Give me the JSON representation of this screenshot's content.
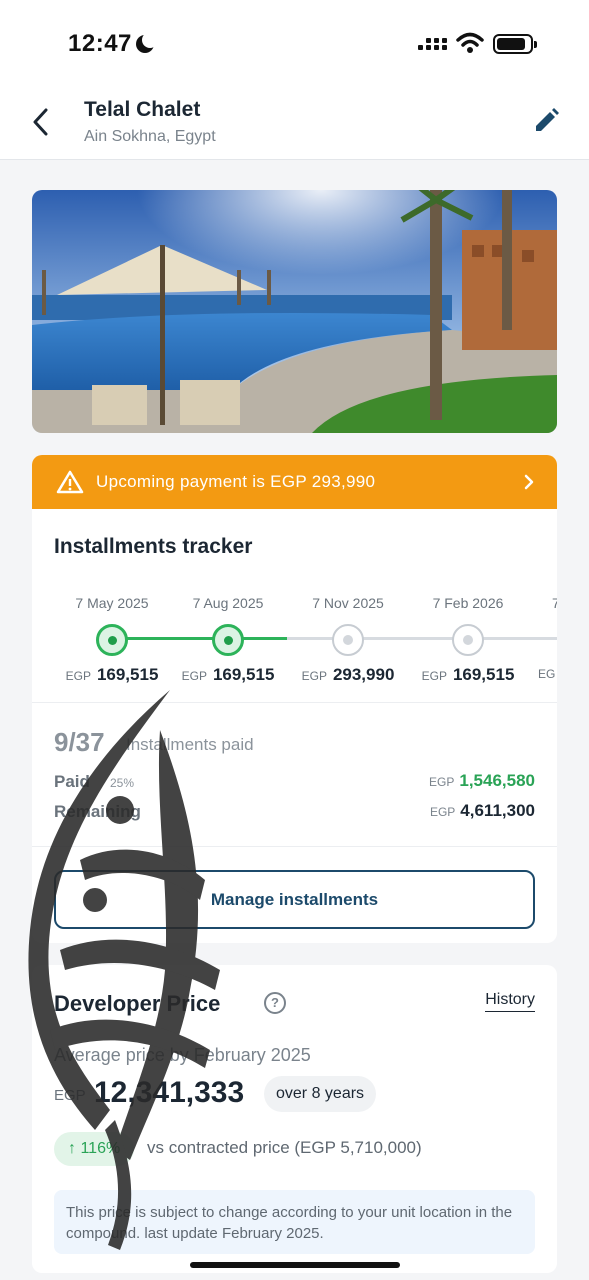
{
  "status_bar": {
    "time": "12:47",
    "icons": [
      "moon-icon",
      "signal-icon",
      "wifi-icon",
      "battery-icon"
    ]
  },
  "header": {
    "title": "Telal Chalet",
    "subtitle": "Ain Sokhna, Egypt",
    "back_icon": "chevron-left-icon",
    "edit_icon": "pencil-icon"
  },
  "alert": {
    "text": "Upcoming payment is EGP 293,990",
    "color": "#f39a12"
  },
  "tracker": {
    "title": "Installments tracker",
    "currency": "EGP",
    "items": [
      {
        "date": "7 May 2025",
        "amount": "169,515",
        "status": "paid"
      },
      {
        "date": "7 Aug 2025",
        "amount": "169,515",
        "status": "paid"
      },
      {
        "date": "7 Nov 2025",
        "amount": "293,990",
        "status": "upcoming"
      },
      {
        "date": "7 Feb 2026",
        "amount": "169,515",
        "status": "upcoming"
      },
      {
        "date": "7",
        "amount": "",
        "status": "upcoming"
      }
    ],
    "partial_currency": "EG"
  },
  "summary": {
    "count": "9/37",
    "count_label": "Installments paid",
    "paid_label": "Paid",
    "paid_pct": "25%",
    "paid_currency": "EGP",
    "paid_amount": "1,546,580",
    "remaining_label": "Remaining",
    "remaining_currency": "EGP",
    "remaining_amount": "4,611,300",
    "manage_button": "Manage installments"
  },
  "developer_price": {
    "title": "Developer Price",
    "history_link": "History",
    "avg_label": "Average price by February 2025",
    "currency": "EGP",
    "value": "12,341,333",
    "years_chip": "over 8 years",
    "growth": "116%",
    "vs_text": "vs contracted price (EGP 5,710,000)",
    "note": "This price is subject to change according to your unit location in the compound. last update February 2025."
  },
  "colors": {
    "accent_green": "#2db35a",
    "primary_dark": "#1c4a6b",
    "alert_orange": "#f39a12"
  }
}
